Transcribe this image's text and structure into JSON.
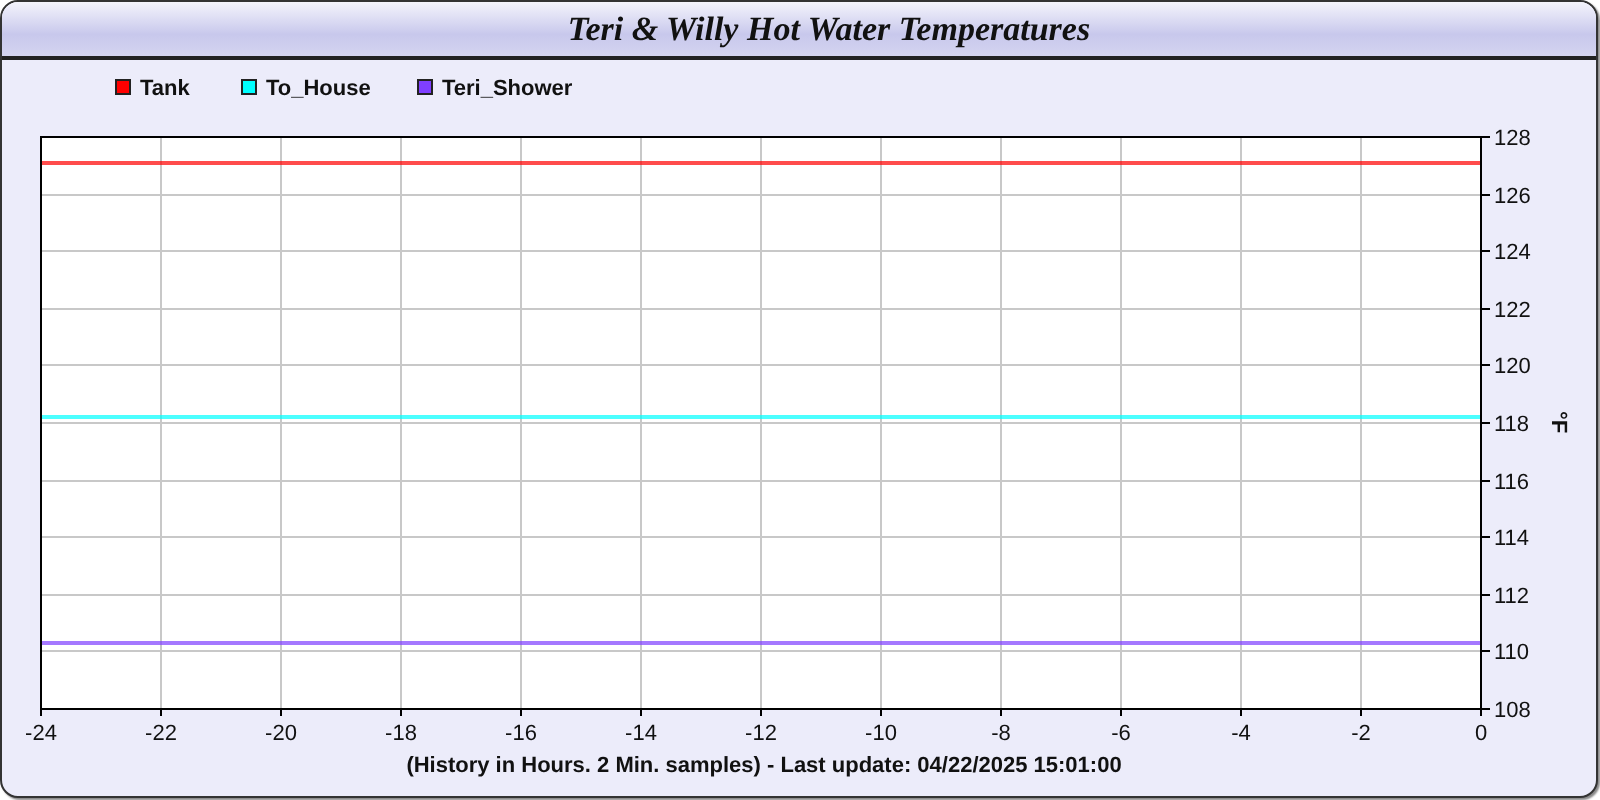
{
  "window": {
    "title": "Teri & Willy Hot Water Temperatures"
  },
  "chart_data": {
    "type": "line",
    "xlabel": "(History in Hours. 2 Min. samples) - Last update: 04/22/2025 15:01:00",
    "ylabel": "°F",
    "x": [
      -24,
      0
    ],
    "grid": true,
    "legend": true,
    "xlim": [
      -24,
      0
    ],
    "ylim": [
      108,
      128
    ],
    "xticks": [
      -24,
      -22,
      -20,
      -18,
      -16,
      -14,
      -12,
      -10,
      -8,
      -6,
      -4,
      -2,
      0
    ],
    "yticks": [
      108,
      110,
      112,
      114,
      116,
      118,
      120,
      122,
      124,
      126,
      128
    ],
    "series": [
      {
        "name": "Tank",
        "color": "#ff0000",
        "values": [
          127.1,
          127.1
        ]
      },
      {
        "name": "To_House",
        "color": "#00ffff",
        "values": [
          118.2,
          118.2
        ]
      },
      {
        "name": "Teri_Shower",
        "color": "#7f3fff",
        "values": [
          110.3,
          110.3
        ]
      }
    ]
  }
}
